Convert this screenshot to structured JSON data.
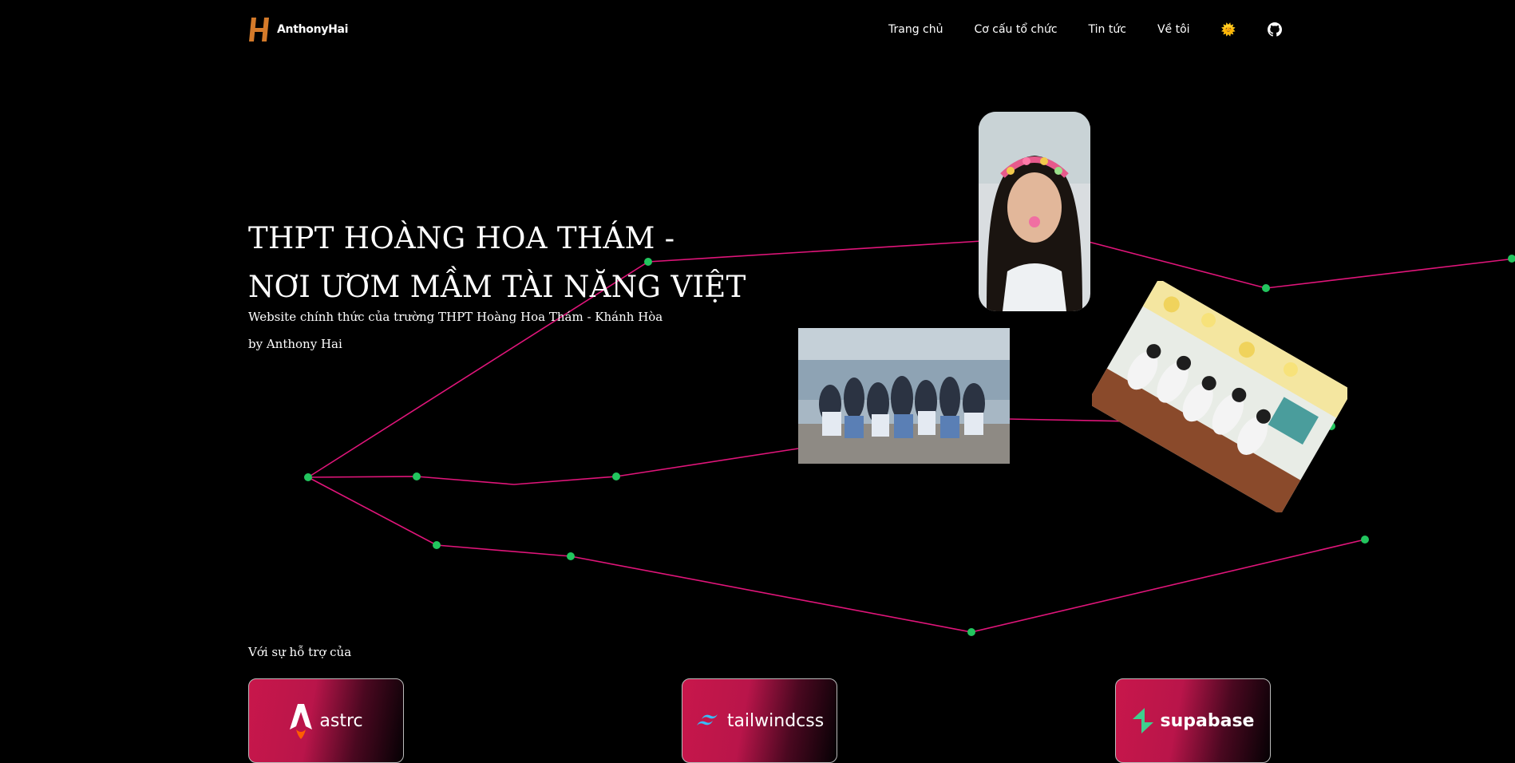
{
  "header": {
    "brand": "AnthonyHai",
    "nav": [
      "Trang chủ",
      "Cơ cấu tổ chức",
      "Tin tức",
      "Về tôi"
    ],
    "theme_icon": "sun-icon",
    "github_icon": "github-icon"
  },
  "hero": {
    "title_line1": "THPT HOÀNG HOA THÁM -",
    "title_line2": "NƠI ƯƠM MẦM TÀI NĂNG VIỆT",
    "subtitle": "Website chính thức của trường THPT Hoàng Hoa Thám - Khánh Hòa",
    "byline": "by Anthony Hai"
  },
  "support": {
    "heading": "Với sự hỗ trợ của",
    "partners": [
      {
        "name": "astro",
        "label": "astrc",
        "icon": "astro-icon"
      },
      {
        "name": "tailwindcss",
        "label": "tailwindcss",
        "icon": "tailwind-icon"
      },
      {
        "name": "supabase",
        "label": "supabase",
        "icon": "supabase-icon"
      }
    ]
  },
  "colors": {
    "background": "#000000",
    "line": "#e0157a",
    "dot": "#22c55e",
    "brand_orange": "#d47a2a",
    "card_red": "#c8174b"
  }
}
